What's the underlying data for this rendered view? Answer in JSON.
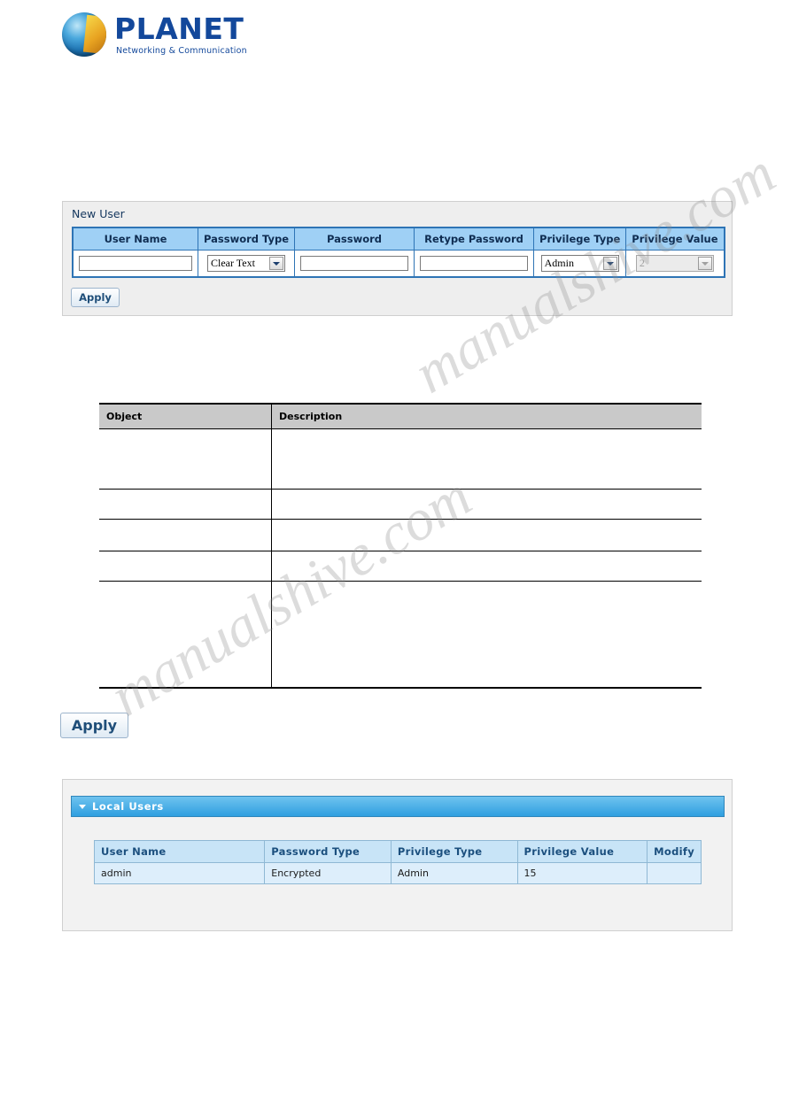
{
  "brand": {
    "name": "PLANET",
    "tagline": "Networking & Communication"
  },
  "new_user": {
    "panel_title": "New User",
    "columns": [
      "User Name",
      "Password Type",
      "Password",
      "Retype Password",
      "Privilege Type",
      "Privilege Value"
    ],
    "fields": {
      "user_name_value": "",
      "password_type_value": "Clear Text",
      "password_value": "",
      "retype_password_value": "",
      "privilege_type_value": "Admin",
      "privilege_value_value": "2"
    },
    "apply_label": "Apply"
  },
  "apply_button": {
    "label": "Apply"
  },
  "description_table": {
    "headers": [
      "Object",
      "Description"
    ],
    "rows": [
      {
        "object": "",
        "description": ""
      },
      {
        "object": "",
        "description": ""
      },
      {
        "object": "",
        "description": ""
      },
      {
        "object": "",
        "description": ""
      },
      {
        "object": "",
        "description": ""
      }
    ]
  },
  "local_users": {
    "panel_title": "Local Users",
    "columns": [
      "User Name",
      "Password Type",
      "Privilege Type",
      "Privilege Value",
      "Modify"
    ],
    "rows": [
      {
        "user_name": "admin",
        "password_type": "Encrypted",
        "privilege_type": "Admin",
        "privilege_value": "15",
        "modify": ""
      }
    ]
  },
  "watermark": {
    "line1": "manualshive.com",
    "line2": "manualshive.com"
  },
  "colors": {
    "brand_blue": "#13489b",
    "table_header_blue": "#9fd0f5",
    "panel_header_gradient_top": "#6fc3ef",
    "panel_header_gradient_bottom": "#2f9fe0"
  }
}
